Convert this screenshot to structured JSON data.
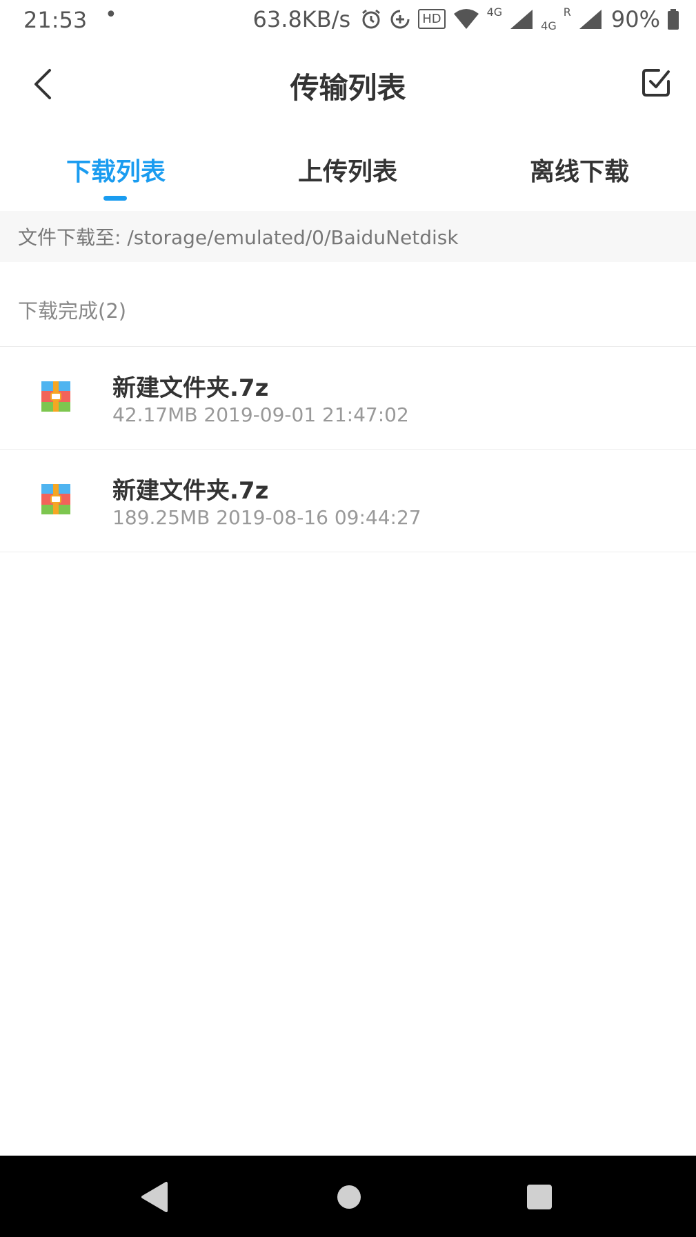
{
  "status_bar": {
    "time": "21:53",
    "dot": "•",
    "speed": "63.8KB/s",
    "hd_label": "HD",
    "net_4g_top": "4G",
    "net_4g_bottom": "4G",
    "roaming": "R",
    "battery": "90%"
  },
  "header": {
    "title": "传输列表"
  },
  "tabs": [
    {
      "label": "下载列表",
      "active": true
    },
    {
      "label": "上传列表",
      "active": false
    },
    {
      "label": "离线下载",
      "active": false
    }
  ],
  "path_bar": {
    "text": "文件下载至: /storage/emulated/0/BaiduNetdisk"
  },
  "section": {
    "title": "下载完成(2)"
  },
  "files": [
    {
      "name": "新建文件夹.7z",
      "meta": "42.17MB 2019-09-01 21:47:02",
      "icon": "archive-icon"
    },
    {
      "name": "新建文件夹.7z",
      "meta": "189.25MB 2019-08-16 09:44:27",
      "icon": "archive-icon"
    }
  ],
  "colors": {
    "accent": "#1a9cf0",
    "text_primary": "#333333",
    "text_secondary": "#999999",
    "nav_bar": "#000000"
  }
}
